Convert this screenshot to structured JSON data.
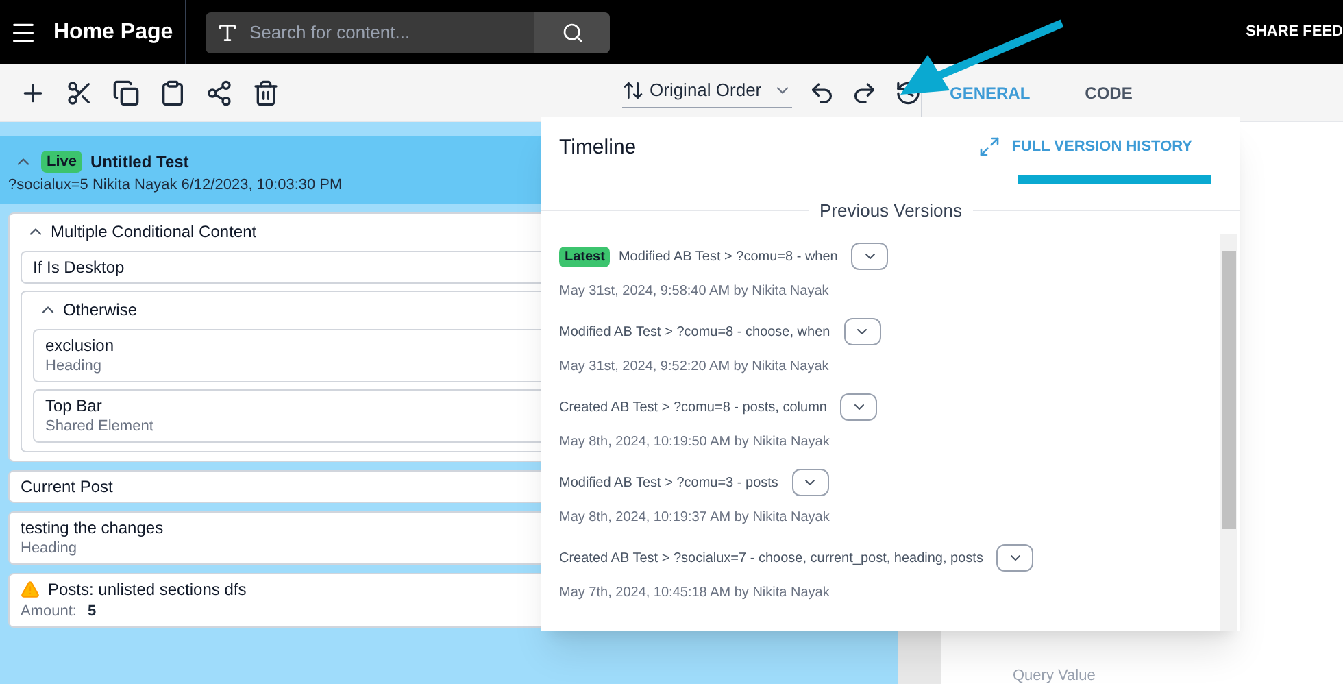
{
  "header": {
    "title": "Home Page",
    "search": {
      "placeholder": "Search for content..."
    },
    "share_button": "SHARE FEED"
  },
  "toolbar": {
    "sort": "Original Order"
  },
  "panel_tabs": [
    {
      "label": "GENERAL",
      "selected": true
    },
    {
      "label": "CODE",
      "selected": false
    }
  ],
  "test": {
    "badge": "Live",
    "title": "Untitled Test",
    "expanded": true,
    "meta": "?socialux=5 Nikita Nayak 6/12/2023, 10:03:30 PM"
  },
  "tree": [
    {
      "kind": "group",
      "title": "Multiple Conditional Content",
      "expanded": true,
      "children": [
        {
          "kind": "condition",
          "title": "If Is Desktop"
        },
        {
          "kind": "group",
          "title": "Otherwise",
          "expanded": true,
          "children": [
            {
              "kind": "block",
              "title": "exclusion",
              "subtitle": "Heading"
            },
            {
              "kind": "block",
              "title": "Top Bar",
              "subtitle": "Shared Element"
            }
          ]
        }
      ]
    },
    {
      "kind": "condition",
      "title": "Current Post"
    },
    {
      "kind": "block",
      "title": "testing the changes",
      "subtitle": "Heading"
    },
    {
      "kind": "warning",
      "title": "Posts: unlisted sections dfs",
      "amount_label": "Amount:",
      "amount_value": "5"
    }
  ],
  "timeline": {
    "title": "Timeline",
    "full_history_link": "FULL VERSION HISTORY",
    "section_title": "Previous Versions",
    "versions": [
      {
        "latest_badge": "Latest",
        "summary": "Modified AB Test > ?comu=8 - when",
        "meta": "May 31st, 2024, 9:58:40 AM by Nikita Nayak"
      },
      {
        "summary": "Modified AB Test > ?comu=8 - choose, when",
        "meta": "May 31st, 2024, 9:52:20 AM by Nikita Nayak"
      },
      {
        "summary": "Created AB Test > ?comu=8 - posts, column",
        "meta": "May 8th, 2024, 10:19:50 AM by Nikita Nayak"
      },
      {
        "summary": "Modified AB Test > ?comu=3 - posts",
        "meta": "May 8th, 2024, 10:19:37 AM by Nikita Nayak"
      },
      {
        "summary": "Created AB Test > ?socialux=7 - choose, current_post, heading, posts",
        "meta": "May 7th, 2024, 10:45:18 AM by Nikita Nayak"
      }
    ]
  },
  "right_panel": {
    "field_label": "Query Value"
  }
}
